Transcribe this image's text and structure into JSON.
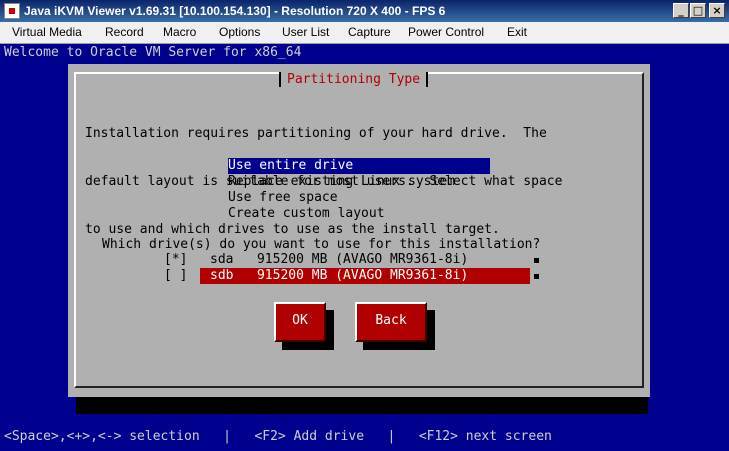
{
  "window": {
    "title": "Java iKVM Viewer v1.69.31 [10.100.154.130] - Resolution 720 X 400 - FPS 6",
    "minimize": "_",
    "maximize": "□",
    "close": "×"
  },
  "menu": {
    "items": [
      "Virtual Media",
      "Record",
      "Macro",
      "Options",
      "User List",
      "Capture",
      "Power Control",
      "Exit"
    ]
  },
  "console": {
    "welcome": "Welcome to Oracle VM Server for x86_64",
    "dialog_title": "Partitioning Type",
    "intro_lines": [
      "Installation requires partitioning of your hard drive.  The",
      "default layout is suitable for most users.  Select what space",
      "to use and which drives to use as the install target."
    ],
    "options": [
      "Use entire drive",
      "Replace existing Linux system",
      "Use free space",
      "Create custom layout"
    ],
    "selected_option": "Use entire drive",
    "question": "Which drive(s) do you want to use for this installation?",
    "drives": [
      {
        "checkbox": "[*]",
        "label": "sda   915200 MB (AVAGO MR9361-8i)"
      },
      {
        "checkbox": "[ ]",
        "label": "sdb   915200 MB (AVAGO MR9361-8i)"
      }
    ],
    "ok_label": "OK",
    "back_label": "Back",
    "help_line": "<Space>,<+>,<-> selection   |   <F2> Add drive   |   <F12> next screen"
  },
  "colors": {
    "console_bg": "#00008f",
    "dialog_bg": "#b0b0b0",
    "accent_red": "#b00000"
  }
}
